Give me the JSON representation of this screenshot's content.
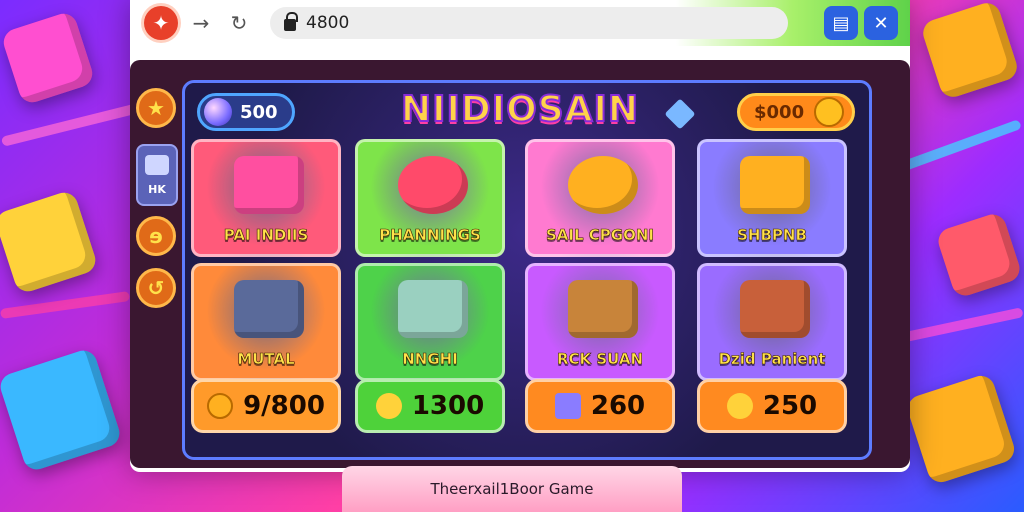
{
  "browser": {
    "address": "4800"
  },
  "header": {
    "gems": "500",
    "title": "NIIDIOSAIN",
    "cash": "$000"
  },
  "sidebar": {
    "card_label": "HK"
  },
  "tiles": [
    {
      "label": "PAI INDIIS",
      "color": "#ff5a7a"
    },
    {
      "label": "PHANNINGS",
      "color": "#7ee44a"
    },
    {
      "label": "SAIL CPGONI",
      "color": "#ff7ad0"
    },
    {
      "label": "SHBPNB",
      "color": "#8a7cff"
    },
    {
      "label": "MUTAL",
      "color": "#ff8a3a"
    },
    {
      "label": "NNGHI",
      "color": "#4ed24a"
    },
    {
      "label": "RCK SUAN",
      "color": "#c85aff"
    },
    {
      "label": "Dzid Panient",
      "color": "#9a6cff"
    }
  ],
  "prices": [
    {
      "value": "9/800",
      "color": "#ff9a2a"
    },
    {
      "value": "1300",
      "color": "#4ed23a"
    },
    {
      "value": "260",
      "color": "#ff8a20"
    },
    {
      "value": "250",
      "color": "#ff8a20"
    }
  ],
  "footer": {
    "text": "Theerxail1Boor Game"
  }
}
